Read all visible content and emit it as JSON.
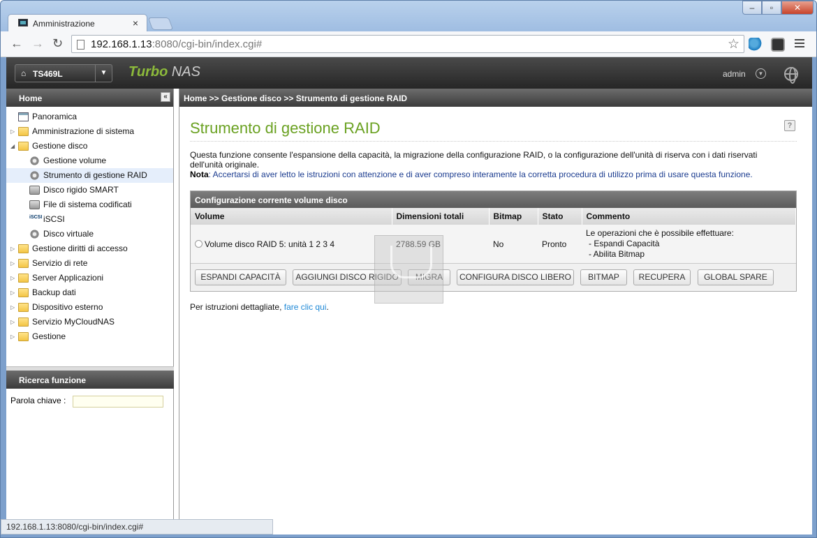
{
  "browser": {
    "tab_title": "Amministrazione",
    "tab_close": "×",
    "url_host": "192.168.1.13",
    "url_rest": ":8080/cgi-bin/index.cgi#",
    "status_url": "192.168.1.13:8080/cgi-bin/index.cgi#"
  },
  "header": {
    "model": "TS469L",
    "brand_turbo": "Turbo",
    "brand_nas": "NAS",
    "user": "admin"
  },
  "sidebar": {
    "title": "Home",
    "items": [
      {
        "label": "Panoramica"
      },
      {
        "label": "Amministrazione di sistema"
      },
      {
        "label": "Gestione disco"
      },
      {
        "label": "Gestione volume"
      },
      {
        "label": "Strumento di gestione RAID"
      },
      {
        "label": "Disco rigido SMART"
      },
      {
        "label": "File di sistema codificati"
      },
      {
        "label": "iSCSI"
      },
      {
        "label": "Disco virtuale"
      },
      {
        "label": "Gestione diritti di accesso"
      },
      {
        "label": "Servizio di rete"
      },
      {
        "label": "Server Applicazioni"
      },
      {
        "label": "Backup dati"
      },
      {
        "label": "Dispositivo esterno"
      },
      {
        "label": "Servizio MyCloudNAS"
      },
      {
        "label": "Gestione"
      }
    ],
    "search_title": "Ricerca funzione",
    "search_label": "Parola chiave :"
  },
  "main": {
    "breadcrumb": "Home >> Gestione disco >> Strumento di gestione RAID",
    "title": "Strumento di gestione RAID",
    "description": "Questa funzione consente l'espansione della capacità, la migrazione della configurazione RAID, o la configurazione dell'unità di riserva con i dati riservati dell'unità originale.",
    "note_label": "Nota",
    "note_text": ": Accertarsi di aver letto le istruzioni con attenzione e di aver compreso interamente la corretta procedura di utilizzo prima di usare questa funzione.",
    "panel_title": "Configurazione corrente volume disco",
    "table": {
      "headers": [
        "Volume",
        "Dimensioni totali",
        "Bitmap",
        "Stato",
        "Commento"
      ],
      "row": {
        "volume": "Volume disco RAID 5: unità 1 2 3 4",
        "size": "2788.59 GB",
        "bitmap": "No",
        "state": "Pronto",
        "comment_title": "Le operazioni che è possibile effettuare:",
        "comment_line1": "- Espandi Capacità",
        "comment_line2": "- Abilita Bitmap"
      }
    },
    "buttons": {
      "expand": "ESPANDI CAPACITÀ",
      "add_disk": "AGGIUNGI DISCO RIGIDO",
      "migrate": "MIGRA",
      "config_spare": "CONFIGURA DISCO LIBERO",
      "bitmap": "BITMAP",
      "recover": "RECUPERA",
      "global_spare": "GLOBAL SPARE"
    },
    "instr_text": "Per istruzioni dettagliate, ",
    "instr_link": "fare clic qui",
    "instr_end": "."
  }
}
